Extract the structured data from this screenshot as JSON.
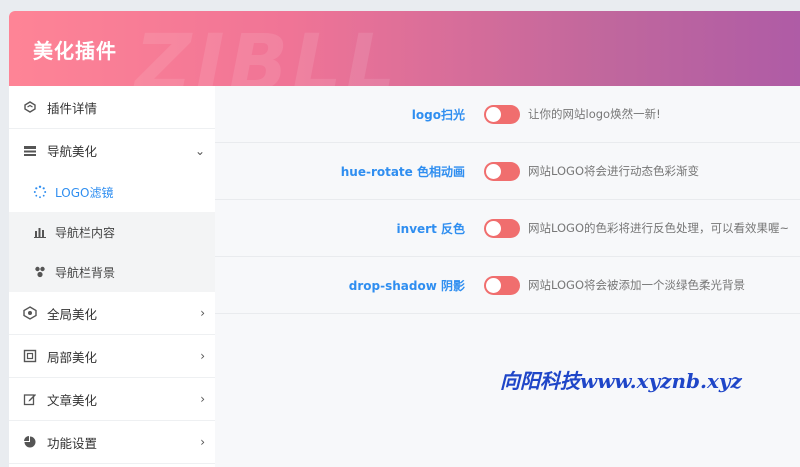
{
  "header": {
    "title": "美化插件",
    "watermark": "ZIBLL"
  },
  "sidebar": {
    "items": [
      {
        "label": "插件详情",
        "icon": "puzzle-icon",
        "has_chevron": false
      },
      {
        "label": "导航美化",
        "icon": "nav-icon",
        "has_chevron": true,
        "chevron": "⌄"
      },
      {
        "label": "全局美化",
        "icon": "global-icon",
        "has_chevron": true,
        "chevron": "›"
      },
      {
        "label": "局部美化",
        "icon": "frame-icon",
        "has_chevron": true,
        "chevron": "›"
      },
      {
        "label": "文章美化",
        "icon": "edit-icon",
        "has_chevron": true,
        "chevron": "›"
      },
      {
        "label": "功能设置",
        "icon": "pie-icon",
        "has_chevron": true,
        "chevron": "›"
      }
    ],
    "subitems": [
      {
        "label": "LOGO滤镜",
        "icon": "spinner-icon",
        "active": true
      },
      {
        "label": "导航栏内容",
        "icon": "bar-chart-icon",
        "active": false
      },
      {
        "label": "导航栏背景",
        "icon": "drops-icon",
        "active": false
      }
    ]
  },
  "settings": [
    {
      "label": "logo扫光",
      "desc": "让你的网站logo焕然一新!",
      "enabled": false
    },
    {
      "label": "hue-rotate 色相动画",
      "desc": "网站LOGO将会进行动态色彩渐变",
      "enabled": false
    },
    {
      "label": "invert 反色",
      "desc": "网站LOGO的色彩将进行反色处理，可以看效果喔~",
      "enabled": false
    },
    {
      "label": "drop-shadow 阴影",
      "desc": "网站LOGO将会被添加一个淡绿色柔光背景",
      "enabled": false
    }
  ],
  "footer_watermark": "向阳科技www.xyznb.xyz",
  "colors": {
    "accent": "#2f8ef0",
    "toggle": "#f06e6e",
    "header_start": "#fe8496",
    "header_end": "#ae5ba6"
  }
}
